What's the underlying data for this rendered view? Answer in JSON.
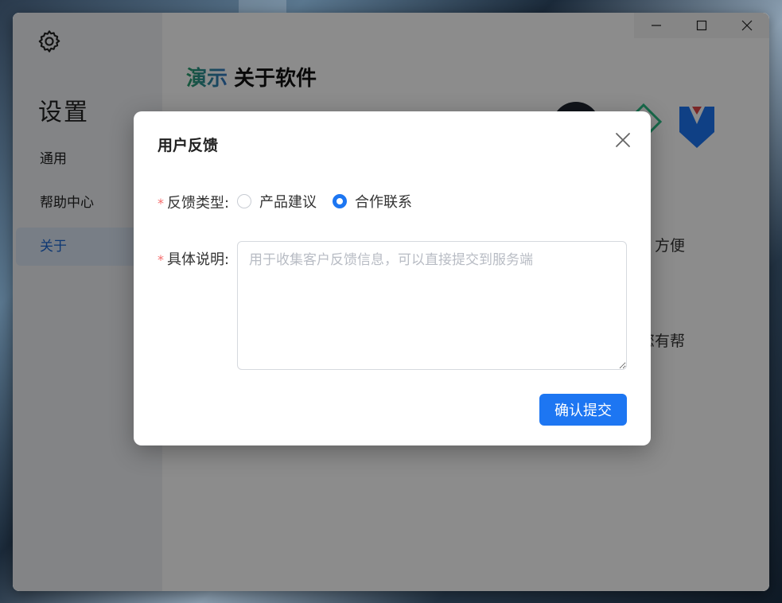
{
  "sidebar": {
    "heading": "设置",
    "items": [
      {
        "label": "通用",
        "active": false
      },
      {
        "label": "帮助中心",
        "active": false
      },
      {
        "label": "关于",
        "active": true
      }
    ]
  },
  "main": {
    "title_brand": "演示",
    "title_text": "关于软件",
    "partial_text_1": "，方便",
    "partial_text_2": "您有帮"
  },
  "dialog": {
    "title": "用户反馈",
    "feedback_type": {
      "label": "反馈类型:",
      "options": [
        {
          "label": "产品建议",
          "checked": false
        },
        {
          "label": "合作联系",
          "checked": true
        }
      ]
    },
    "description": {
      "label": "具体说明:",
      "value": "",
      "placeholder": "用于收集客户反馈信息，可以直接提交到服务端"
    },
    "submit_label": "确认提交"
  },
  "colors": {
    "primary": "#1d76f2",
    "required_star": "#f56c6c",
    "sidebar_bg": "#eef1f5",
    "active_item_text": "#1a66d2"
  },
  "icons": [
    "gear-icon",
    "minimize-icon",
    "maximize-icon",
    "close-icon",
    "dialog-close-icon"
  ]
}
